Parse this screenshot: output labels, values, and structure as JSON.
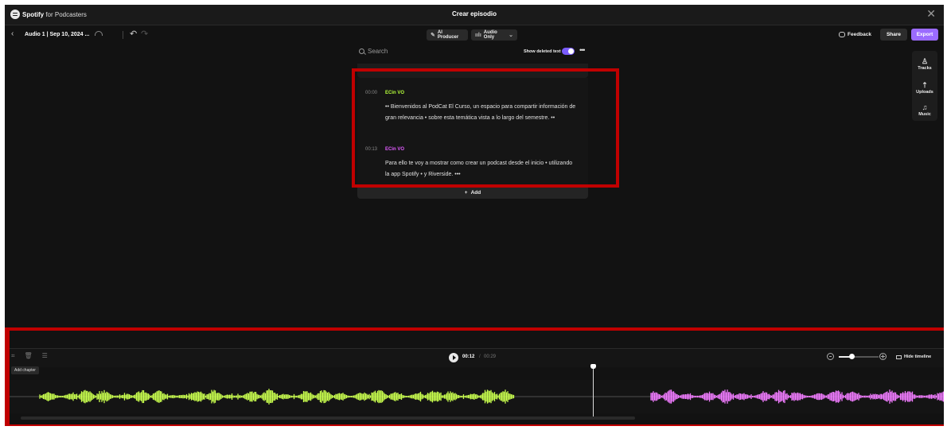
{
  "titlebar": {
    "brand_strong": "Spotify",
    "brand_light": " for Podcasters",
    "window_title": "Crear episodio",
    "close_glyph": "✕"
  },
  "toolbar": {
    "back_glyph": "‹",
    "episode_name": "Audio 1 | Sep 10, 2024 ...",
    "undo_glyph": "↶",
    "redo_glyph": "↷",
    "ai_producer_label": "AI Producer",
    "audio_only_label": "Audio Only",
    "feedback_label": "Feedback",
    "share_label": "Share",
    "export_label": "Export"
  },
  "search": {
    "placeholder": "Search",
    "show_deleted_label": "Show deleted text",
    "show_deleted_on": true,
    "more_glyph": "•••"
  },
  "transcript": {
    "segments": [
      {
        "time": "00:00",
        "speaker": "ECin VO",
        "speaker_color": "#b6ff3b",
        "text": "•• Bienvenidos al PodCat El Curso, un espacio para compartir información de gran relevancia • sobre esta temática vista a lo largo del semestre. ••"
      },
      {
        "time": "00:13",
        "speaker": "ECin VO",
        "speaker_color": "#e05bff",
        "text": "Para ello te voy a mostrar como crear un podcast desde el inicio • utilizando la app Spotify • y Riverside. •••"
      }
    ],
    "add_label": "Add"
  },
  "sidepanel": {
    "items": [
      {
        "label": "Tracks",
        "icon": "tracks-icon"
      },
      {
        "label": "Uploads",
        "icon": "upload-icon"
      },
      {
        "label": "Music",
        "icon": "music-icon"
      }
    ]
  },
  "timeline": {
    "add_chapter_tooltip": "Add chapter",
    "current_time": "00:12",
    "separator": "/",
    "total_time": "00:29",
    "zoom_level": 0.3,
    "hide_label": "Hide timeline",
    "playhead_fraction": 0.41,
    "waveform_colors": {
      "first": "#c8ff4d",
      "second": "#f07bff"
    }
  }
}
